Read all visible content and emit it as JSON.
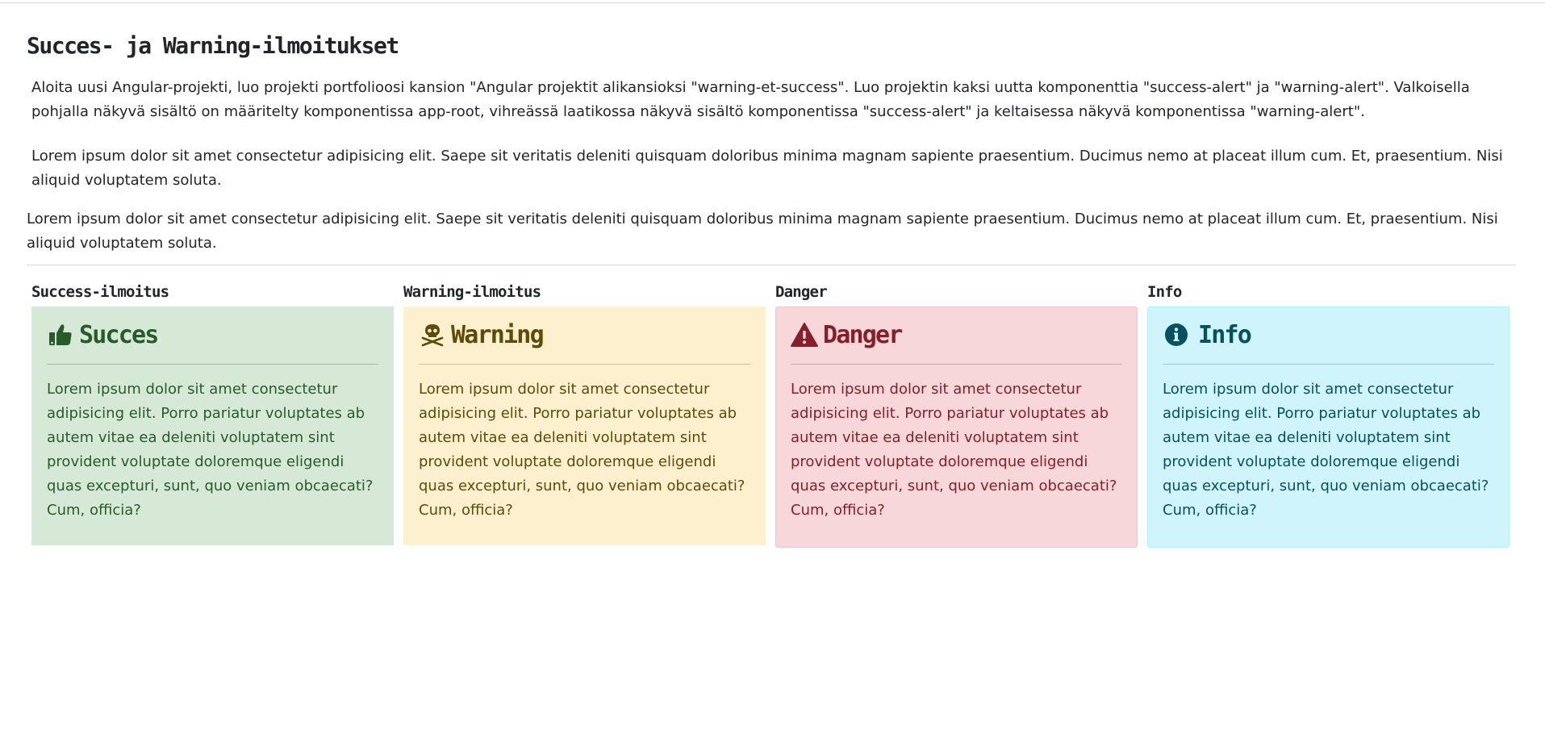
{
  "page": {
    "title": "Succes- ja Warning-ilmoitukset",
    "paragraphs": [
      "Aloita uusi Angular-projekti, luo projekti portfolioosi kansion \"Angular projektit alikansioksi \"warning-et-success\". Luo projektin kaksi uutta komponenttia \"success-alert\" ja \"warning-alert\". Valkoisella pohjalla näkyvä sisältö on määritelty komponentissa app-root, vihreässä laatikossa näkyvä sisältö komponentissa \"success-alert\" ja keltaisessa näkyvä komponentissa \"warning-alert\".",
      "Lorem ipsum dolor sit amet consectetur adipisicing elit. Saepe sit veritatis deleniti quisquam doloribus minima magnam sapiente praesentium. Ducimus nemo at placeat illum cum. Et, praesentium. Nisi aliquid voluptatem soluta.",
      "Lorem ipsum dolor sit amet consectetur adipisicing elit. Saepe sit veritatis deleniti quisquam doloribus minima magnam sapiente praesentium. Ducimus nemo at placeat illum cum. Et, praesentium. Nisi aliquid voluptatem soluta."
    ]
  },
  "alerts": [
    {
      "heading": "Success-ilmoitus",
      "title": "Succes",
      "icon": "thumbs-up-icon",
      "color": "#285b2a",
      "background": "#d6e9d6",
      "body": "Lorem ipsum dolor sit amet consectetur adipisicing elit. Porro pariatur voluptates ab autem vitae ea deleniti voluptatem sint provident voluptate doloremque eligendi quas excepturi, sunt, quo veniam obcaecati? Cum, officia?"
    },
    {
      "heading": "Warning-ilmoitus",
      "title": "Warning",
      "icon": "skull-crossbones-icon",
      "color": "#5f4a07",
      "background": "#fcf0cf",
      "body": "Lorem ipsum dolor sit amet consectetur adipisicing elit. Porro pariatur voluptates ab autem vitae ea deleniti voluptatem sint provident voluptate doloremque eligendi quas excepturi, sunt, quo veniam obcaecati? Cum, officia?"
    },
    {
      "heading": "Danger",
      "title": "Danger",
      "icon": "warning-triangle-icon",
      "color": "#842029",
      "background": "#f8d7da",
      "body": "Lorem ipsum dolor sit amet consectetur adipisicing elit. Porro pariatur voluptates ab autem vitae ea deleniti voluptatem sint provident voluptate doloremque eligendi quas excepturi, sunt, quo veniam obcaecati? Cum, officia?"
    },
    {
      "heading": "Info",
      "title": "Info",
      "icon": "info-circle-icon",
      "color": "#055160",
      "background": "#cff4fc",
      "body": "Lorem ipsum dolor sit amet consectetur adipisicing elit. Porro pariatur voluptates ab autem vitae ea deleniti voluptatem sint provident voluptate doloremque eligendi quas excepturi, sunt, quo veniam obcaecati? Cum, officia?"
    }
  ]
}
